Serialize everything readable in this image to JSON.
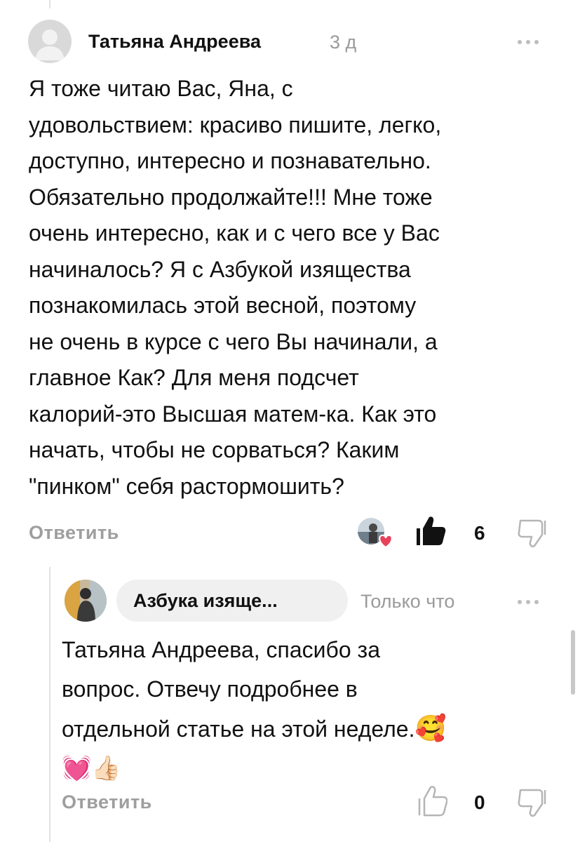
{
  "comment": {
    "author": "Татьяна Андреева",
    "time": "3 д",
    "text_lines": [
      "Я тоже читаю Вас, Яна, с",
      "удовольствием: красиво пишите, легко,",
      "доступно, интересно и познавательно.",
      "Обязательно продолжайте!!! Мне тоже",
      "очень интересно, как и с чего все у Вас",
      "начиналось? Я с Азбукой изящества",
      "познакомилась этой весной, поэтому",
      "не очень в курсе с чего Вы начинали, а",
      "главное Как?  Для меня подсчет",
      "калорий-это Высшая матем-ка. Как это",
      "начать, чтобы не сорваться? Каким",
      "\"пинком\" себя растормошить?"
    ],
    "reply_label": "Ответить",
    "like_count": "6",
    "icons": {
      "avatar": "default-user-avatar",
      "menu": "more-dots-icon",
      "liked_by": "author-heart-avatar",
      "like": "thumbs-up-filled-icon",
      "dislike": "thumbs-down-outline-icon"
    }
  },
  "reply": {
    "author": "Азбука изяще...",
    "time": "Только что",
    "text_lines": [
      "Татьяна Андреева, спасибо за",
      "вопрос. Отвечу подробнее в",
      "отдельной статье на этой неделе."
    ],
    "emoji_line1_end": "🥰",
    "emoji_line2": "💓👍🏻",
    "reply_label": "Ответить",
    "like_count": "0",
    "icons": {
      "avatar": "channel-avatar-photo",
      "menu": "more-dots-icon",
      "like": "thumbs-up-outline-icon",
      "dislike": "thumbs-down-outline-icon"
    }
  },
  "colors": {
    "text": "#111111",
    "muted": "#9a9a9a",
    "pill_bg": "#f0f0f0",
    "heart": "#e8425a"
  }
}
